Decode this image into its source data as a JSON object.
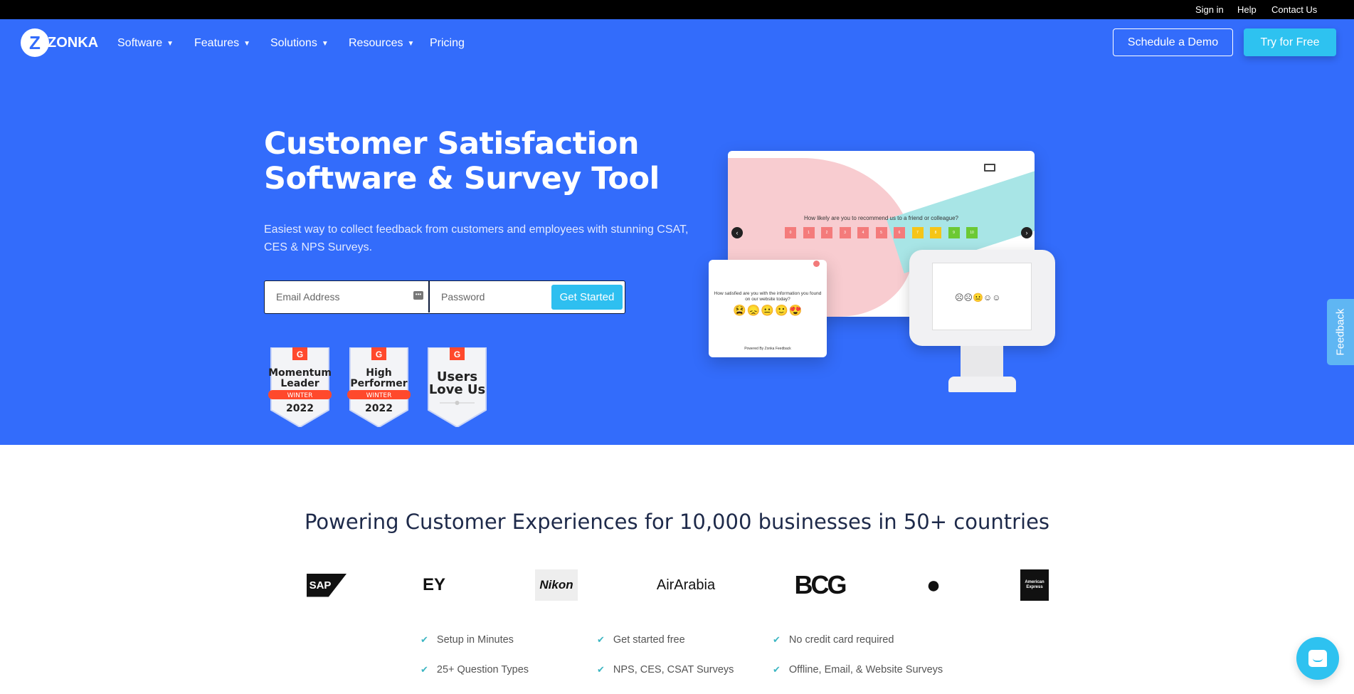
{
  "topbar": {
    "links": [
      "Sign in",
      "Help",
      "Contact Us"
    ]
  },
  "nav": {
    "logo": "ZONKA",
    "items": [
      {
        "label": "Software",
        "dropdown": true
      },
      {
        "label": "Features",
        "dropdown": true
      },
      {
        "label": "Solutions",
        "dropdown": true
      },
      {
        "label": "Resources",
        "dropdown": true
      },
      {
        "label": "Pricing",
        "dropdown": false
      }
    ],
    "schedule_demo": "Schedule a Demo",
    "try_free": "Try for Free"
  },
  "hero": {
    "title_line1": "Customer Satisfaction",
    "title_line2": "Software & Survey Tool",
    "subtitle": "Easiest way to collect feedback from customers and employees with stunning CSAT, CES & NPS Surveys.",
    "email_placeholder": "Email Address",
    "password_placeholder": "Password",
    "cta": "Get Started"
  },
  "badges": [
    {
      "line1": "Momentum",
      "line2": "Leader",
      "ribbon": "WINTER",
      "year": "2022"
    },
    {
      "line1": "High",
      "line2": "Performer",
      "ribbon": "WINTER",
      "year": "2022"
    },
    {
      "line1": "Users",
      "line2": "Love Us",
      "ribbon": "",
      "year": ""
    }
  ],
  "mockup": {
    "nps_question": "How likely are you to recommend us to a friend or colleague?",
    "nps_scale": [
      "0",
      "1",
      "2",
      "3",
      "4",
      "5",
      "6",
      "7",
      "8",
      "9",
      "10"
    ],
    "csat_question": "How satisfied are you with the information you found on our website today?",
    "powered": "Powered By Zonka Feedback"
  },
  "customers": {
    "heading": "Powering Customer Experiences for 10,000 businesses in 50+ countries",
    "logos": [
      "SAP",
      "EY",
      "Nikon",
      "AirArabia",
      "BCG",
      "Apple",
      "American Express"
    ]
  },
  "features": [
    "Setup in Minutes",
    "Get started free",
    "No credit card required",
    "25+ Question Types",
    "NPS, CES, CSAT Surveys",
    "Offline, Email, & Website Surveys"
  ],
  "feedback_tab": "Feedback",
  "colors": {
    "hero_bg": "#336cfb",
    "accent": "#2ec2f0",
    "check": "#3cb6c2",
    "g2_red": "#ff492c"
  }
}
